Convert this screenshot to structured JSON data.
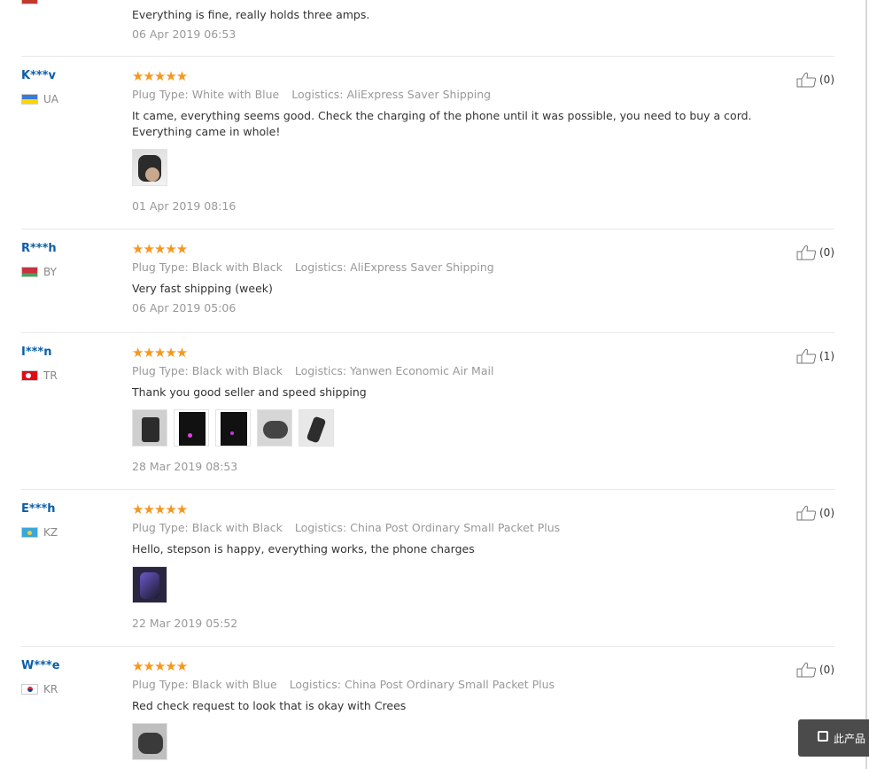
{
  "top_review": {
    "text": "Everything is fine, really holds three amps.",
    "date": "06 Apr 2019 06:53"
  },
  "labels": {
    "plug_type": "Plug Type:",
    "logistics": "Logistics:"
  },
  "reviews": [
    {
      "user": "K***v",
      "country": "UA",
      "stars": "★★★★★",
      "plug_type": "White with Blue",
      "logistics": "AliExpress Saver Shipping",
      "text": "It came, everything seems good. Check the charging of the phone until it was possible, you need to buy a cord. Everything came in whole!",
      "date": "01 Apr 2019 08:16",
      "useful": "(0)"
    },
    {
      "user": "R***h",
      "country": "BY",
      "stars": "★★★★★",
      "plug_type": "Black with Black",
      "logistics": "AliExpress Saver Shipping",
      "text": "Very fast shipping (week)",
      "date": "06 Apr 2019 05:06",
      "useful": "(0)"
    },
    {
      "user": "I***n",
      "country": "TR",
      "stars": "★★★★★",
      "plug_type": "Black with Black",
      "logistics": "Yanwen Economic Air Mail",
      "text": "Thank you good seller and speed shipping",
      "date": "28 Mar 2019 08:53",
      "useful": "(1)"
    },
    {
      "user": "E***h",
      "country": "KZ",
      "stars": "★★★★★",
      "plug_type": "Black with Black",
      "logistics": "China Post Ordinary Small Packet Plus",
      "text": "Hello, stepson is happy, everything works, the phone charges",
      "date": "22 Mar 2019 05:52",
      "useful": "(0)"
    },
    {
      "user": "W***e",
      "country": "KR",
      "stars": "★★★★★",
      "plug_type": "Black with Blue",
      "logistics": "China Post Ordinary Small Packet Plus",
      "text": "Red check request to look that is okay with Crees",
      "useful": "(0)"
    }
  ],
  "float_tab": {
    "label": "此产品"
  }
}
